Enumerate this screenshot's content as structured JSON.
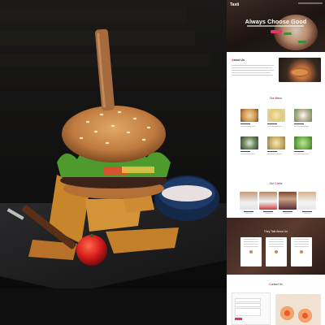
{
  "hero": {
    "logo": "Tasti",
    "title": "Always Choose Good"
  },
  "about": {
    "title_accent": "A",
    "title_rest": "bout Us"
  },
  "menu": {
    "title_pre": "Our ",
    "title_accent": "M",
    "title_post": "enu"
  },
  "chefs": {
    "title_pre": "Our ",
    "title_accent": "Ch",
    "title_post": "efs"
  },
  "testimonials": {
    "title": "They Talk About Us"
  },
  "contact": {
    "title_pre": "",
    "title_accent": "C",
    "title_post": "ontact Us"
  },
  "colors": {
    "accent": "#e8336a",
    "photo_background": "#0b0b0c",
    "bun": "#c98a4b",
    "lettuce": "#4f9a2c",
    "sauce_bowl": "#1e3a66",
    "tomato": "#d61c1c",
    "knife_handle": "#a56a3d"
  },
  "icons": [
    "burger-photo",
    "knife-icon",
    "fork-icon"
  ]
}
